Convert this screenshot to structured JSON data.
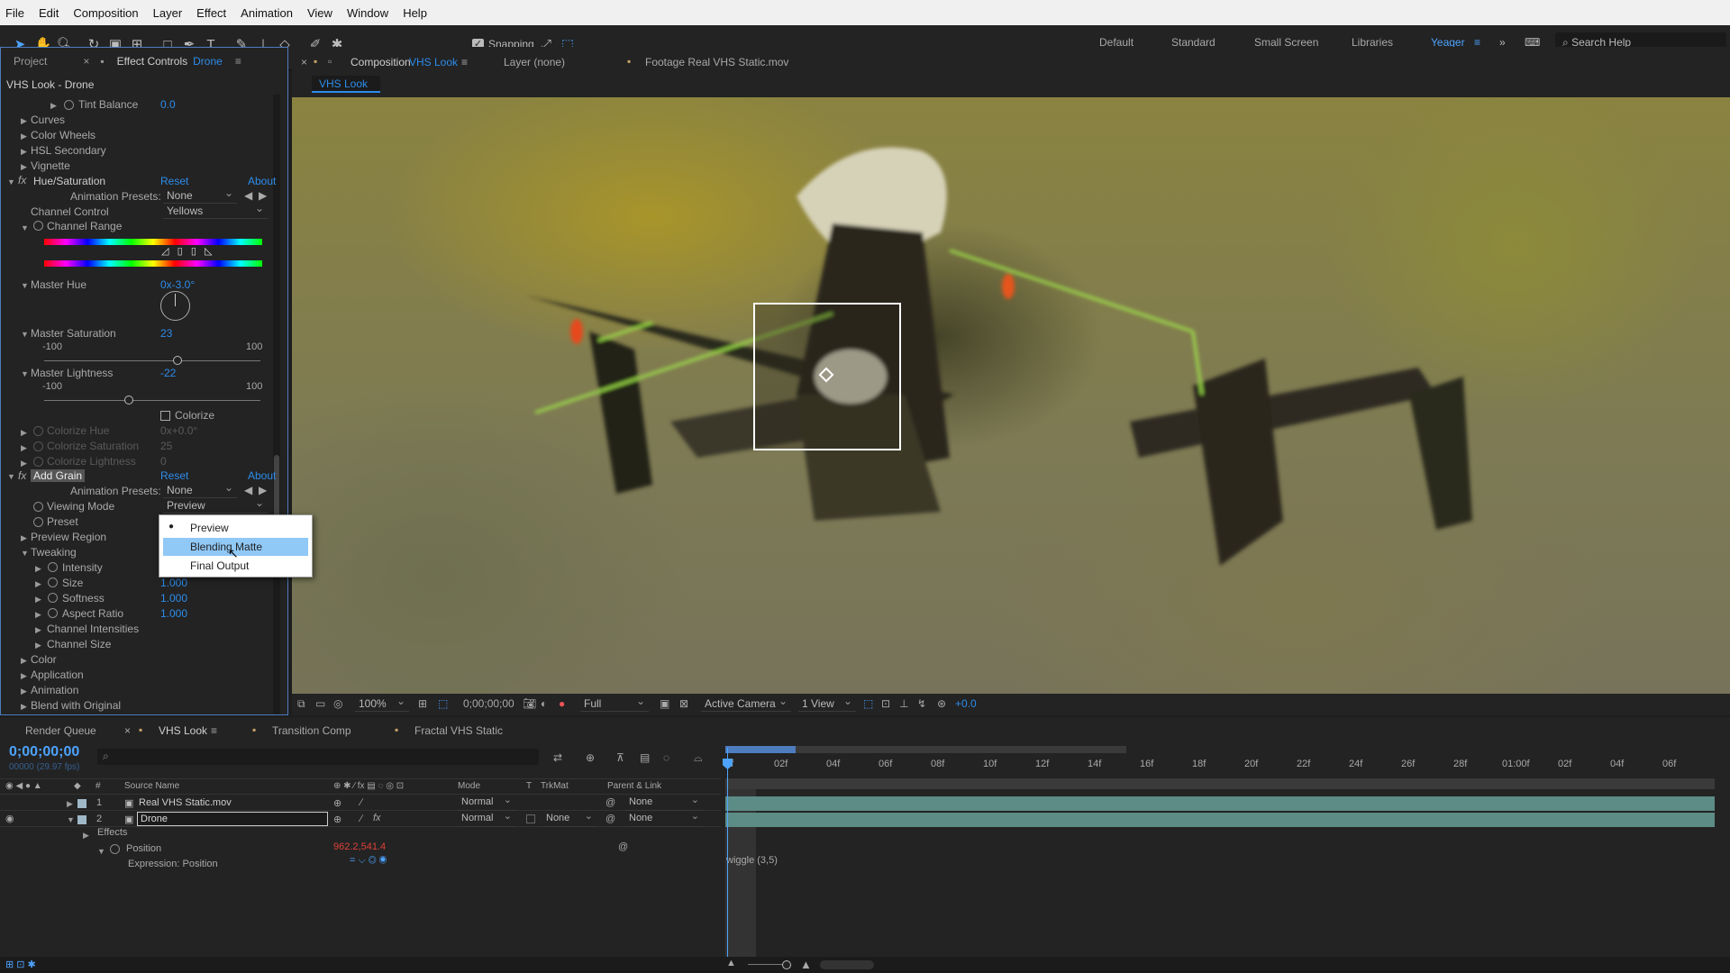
{
  "menu": [
    "File",
    "Edit",
    "Composition",
    "Layer",
    "Effect",
    "Animation",
    "View",
    "Window",
    "Help"
  ],
  "toolbar": {
    "snapping": "Snapping",
    "workspaces": [
      "Default",
      "Standard",
      "Small Screen",
      "Libraries"
    ],
    "active_workspace": "Yeager",
    "search_placeholder": "Search Help"
  },
  "left_panel": {
    "tab_project": "Project",
    "tab_effect_controls": "Effect Controls",
    "tab_effect_target": "Drone",
    "breadcrumb": "VHS Look - Drone",
    "items": {
      "tint_balance": "Tint Balance",
      "tint_balance_value": "0.0",
      "curves": "Curves",
      "color_wheels": "Color Wheels",
      "hsl_secondary": "HSL Secondary",
      "vignette": "Vignette"
    },
    "hue_sat": {
      "name": "Hue/Saturation",
      "reset": "Reset",
      "about": "About",
      "presets_label": "Animation Presets:",
      "presets_value": "None",
      "channel_control_label": "Channel Control",
      "channel_control_value": "Yellows",
      "channel_range": "Channel Range",
      "master_hue": "Master Hue",
      "master_hue_value": "0x-3.0°",
      "master_saturation": "Master Saturation",
      "master_saturation_value": "23",
      "min": "-100",
      "max": "100",
      "master_saturation_level": 0.615,
      "master_lightness": "Master Lightness",
      "master_lightness_value": "-22",
      "master_lightness_level": 0.39,
      "colorize": "Colorize",
      "colorize_hue": "Colorize Hue",
      "colorize_hue_value": "0x+0.0°",
      "colorize_saturation": "Colorize Saturation",
      "colorize_saturation_value": "25",
      "colorize_lightness": "Colorize Lightness",
      "colorize_lightness_value": "0"
    },
    "add_grain": {
      "name": "Add Grain",
      "reset": "Reset",
      "about": "About",
      "presets_label": "Animation Presets:",
      "presets_value": "None",
      "viewing_mode": "Viewing Mode",
      "viewing_mode_value": "Preview",
      "preset": "Preset",
      "preview_region": "Preview Region",
      "tweaking": "Tweaking",
      "intensity": "Intensity",
      "size": "Size",
      "size_value": "1.000",
      "softness": "Softness",
      "softness_value": "1.000",
      "aspect_ratio": "Aspect Ratio",
      "aspect_ratio_value": "1.000",
      "channel_intensities": "Channel Intensities",
      "channel_size": "Channel Size",
      "color": "Color",
      "application": "Application",
      "animation": "Animation",
      "blend": "Blend with Original"
    },
    "dropdown": [
      "Preview",
      "Blending Matte",
      "Final Output"
    ]
  },
  "viewer_panel": {
    "tab_comp_prefix": "Composition",
    "tab_comp_name": "VHS Look",
    "tab_layer": "Layer (none)",
    "tab_footage": "Footage  Real VHS Static.mov",
    "comp_chip": "VHS Look"
  },
  "viewer_controls": {
    "zoom": "100%",
    "timecode": "0;00;00;00",
    "resolution": "Full",
    "camera": "Active Camera",
    "views": "1 View",
    "exposure": "+0.0"
  },
  "timeline": {
    "tabs": [
      "Render Queue",
      "VHS Look",
      "Transition Comp",
      "Fractal VHS Static"
    ],
    "timecode": "0;00;00;00",
    "fps": "00000 (29.97 fps)",
    "headers": {
      "num": "#",
      "source": "Source Name",
      "mode": "Mode",
      "t": "T",
      "trkmat": "TrkMat",
      "parent": "Parent & Link"
    },
    "layers": [
      {
        "num": "1",
        "name": "Real VHS Static.mov",
        "mode": "Normal",
        "parent": "None"
      },
      {
        "num": "2",
        "name": "Drone",
        "mode": "Normal",
        "trkmat": "None",
        "parent": "None"
      }
    ],
    "effects": "Effects",
    "position": "Position",
    "position_value": "962.2,541.4",
    "expression": "Expression: Position",
    "expression_code": "wiggle (3,5)",
    "ruler": [
      "0f",
      "02f",
      "04f",
      "06f",
      "08f",
      "10f",
      "12f",
      "14f",
      "16f",
      "18f",
      "20f",
      "22f",
      "24f",
      "26f",
      "28f",
      "01:00f",
      "02f",
      "04f",
      "06f"
    ]
  }
}
